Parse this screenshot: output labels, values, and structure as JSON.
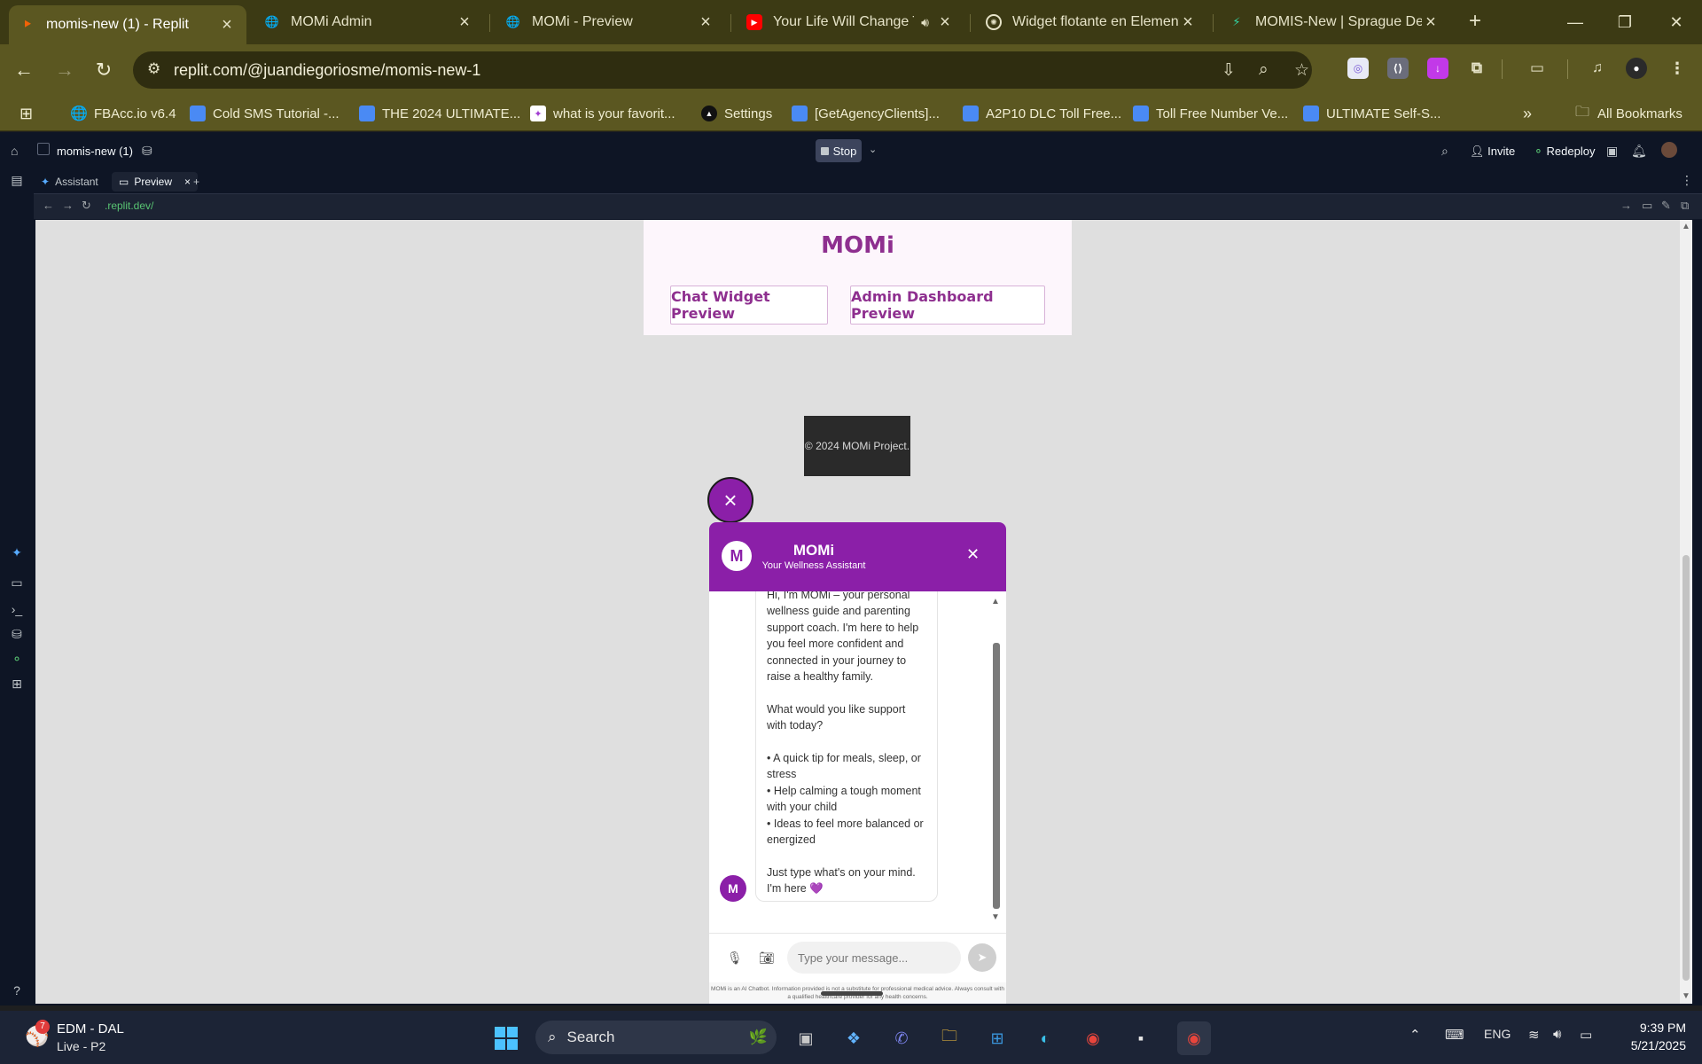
{
  "browser": {
    "tabs": [
      {
        "title": "momis-new (1) - Replit",
        "icon": "replit-icon",
        "active": true
      },
      {
        "title": "MOMi Admin",
        "icon": "globe-icon"
      },
      {
        "title": "MOMi - Preview",
        "icon": "globe-icon"
      },
      {
        "title": "Your Life Will Change Th",
        "icon": "youtube-icon"
      },
      {
        "title": "Widget flotante en Element",
        "icon": "openai-icon"
      },
      {
        "title": "MOMIS-New | Sprague Des",
        "icon": "bolt-icon"
      }
    ],
    "url": "replit.com/@juandiegoriosme/momis-new-1",
    "bookmarks": [
      {
        "label": "FBAcc.io v6.4",
        "icon": "globe-icon"
      },
      {
        "label": "Cold SMS Tutorial -...",
        "icon": "doc-icon"
      },
      {
        "label": "THE 2024 ULTIMATE...",
        "icon": "doc-icon"
      },
      {
        "label": "what is your favorit...",
        "icon": "sparkle-icon"
      },
      {
        "label": "Settings",
        "icon": "triangle-icon"
      },
      {
        "label": "[GetAgencyClients]...",
        "icon": "doc-icon"
      },
      {
        "label": "A2P10 DLC Toll Free...",
        "icon": "doc-icon"
      },
      {
        "label": "Toll Free Number Ve...",
        "icon": "doc-icon"
      },
      {
        "label": "ULTIMATE Self-S...",
        "icon": "doc-icon"
      }
    ],
    "all_bookmarks": "All Bookmarks",
    "brand_color": "#5b5721"
  },
  "replit": {
    "project_name": "momis-new (1)",
    "stop_label": "Stop",
    "invite_label": "Invite",
    "redeploy_label": "Redeploy",
    "tabs": [
      {
        "label": "Assistant"
      },
      {
        "label": "Preview",
        "active": true
      }
    ],
    "preview_url": ".replit.dev/"
  },
  "page": {
    "title": "MOMi",
    "buttons": [
      "Chat Widget Preview",
      "Admin Dashboard Preview"
    ],
    "footer": "© 2024 MOMi Project."
  },
  "widget": {
    "avatar_letter": "M",
    "name": "MOMi",
    "subtitle": "Your Wellness Assistant",
    "accent": "#8b1fa8",
    "message": "Hi, I'm MOMi – your personal wellness guide and parenting support coach. I'm here to help you feel more confident and connected in your journey to raise a healthy family.\n\nWhat would you like support with today?\n\n• A quick tip for meals, sleep, or stress\n• Help calming a tough moment with your child\n• Ideas to feel more balanced or energized\n\nJust type what's on your mind. I'm here 💜",
    "input_placeholder": "Type your message...",
    "disclaimer": "MOMi is an AI Chatbot. Information provided is not a substitute for professional medical advice. Always consult with a qualified healthcare provider for any health concerns."
  },
  "taskbar": {
    "weather_badge": "7",
    "weather_title": "EDM - DAL",
    "weather_sub": "Live - P2",
    "search_label": "Search",
    "language": "ENG",
    "time": "9:39 PM",
    "date": "5/21/2025"
  }
}
